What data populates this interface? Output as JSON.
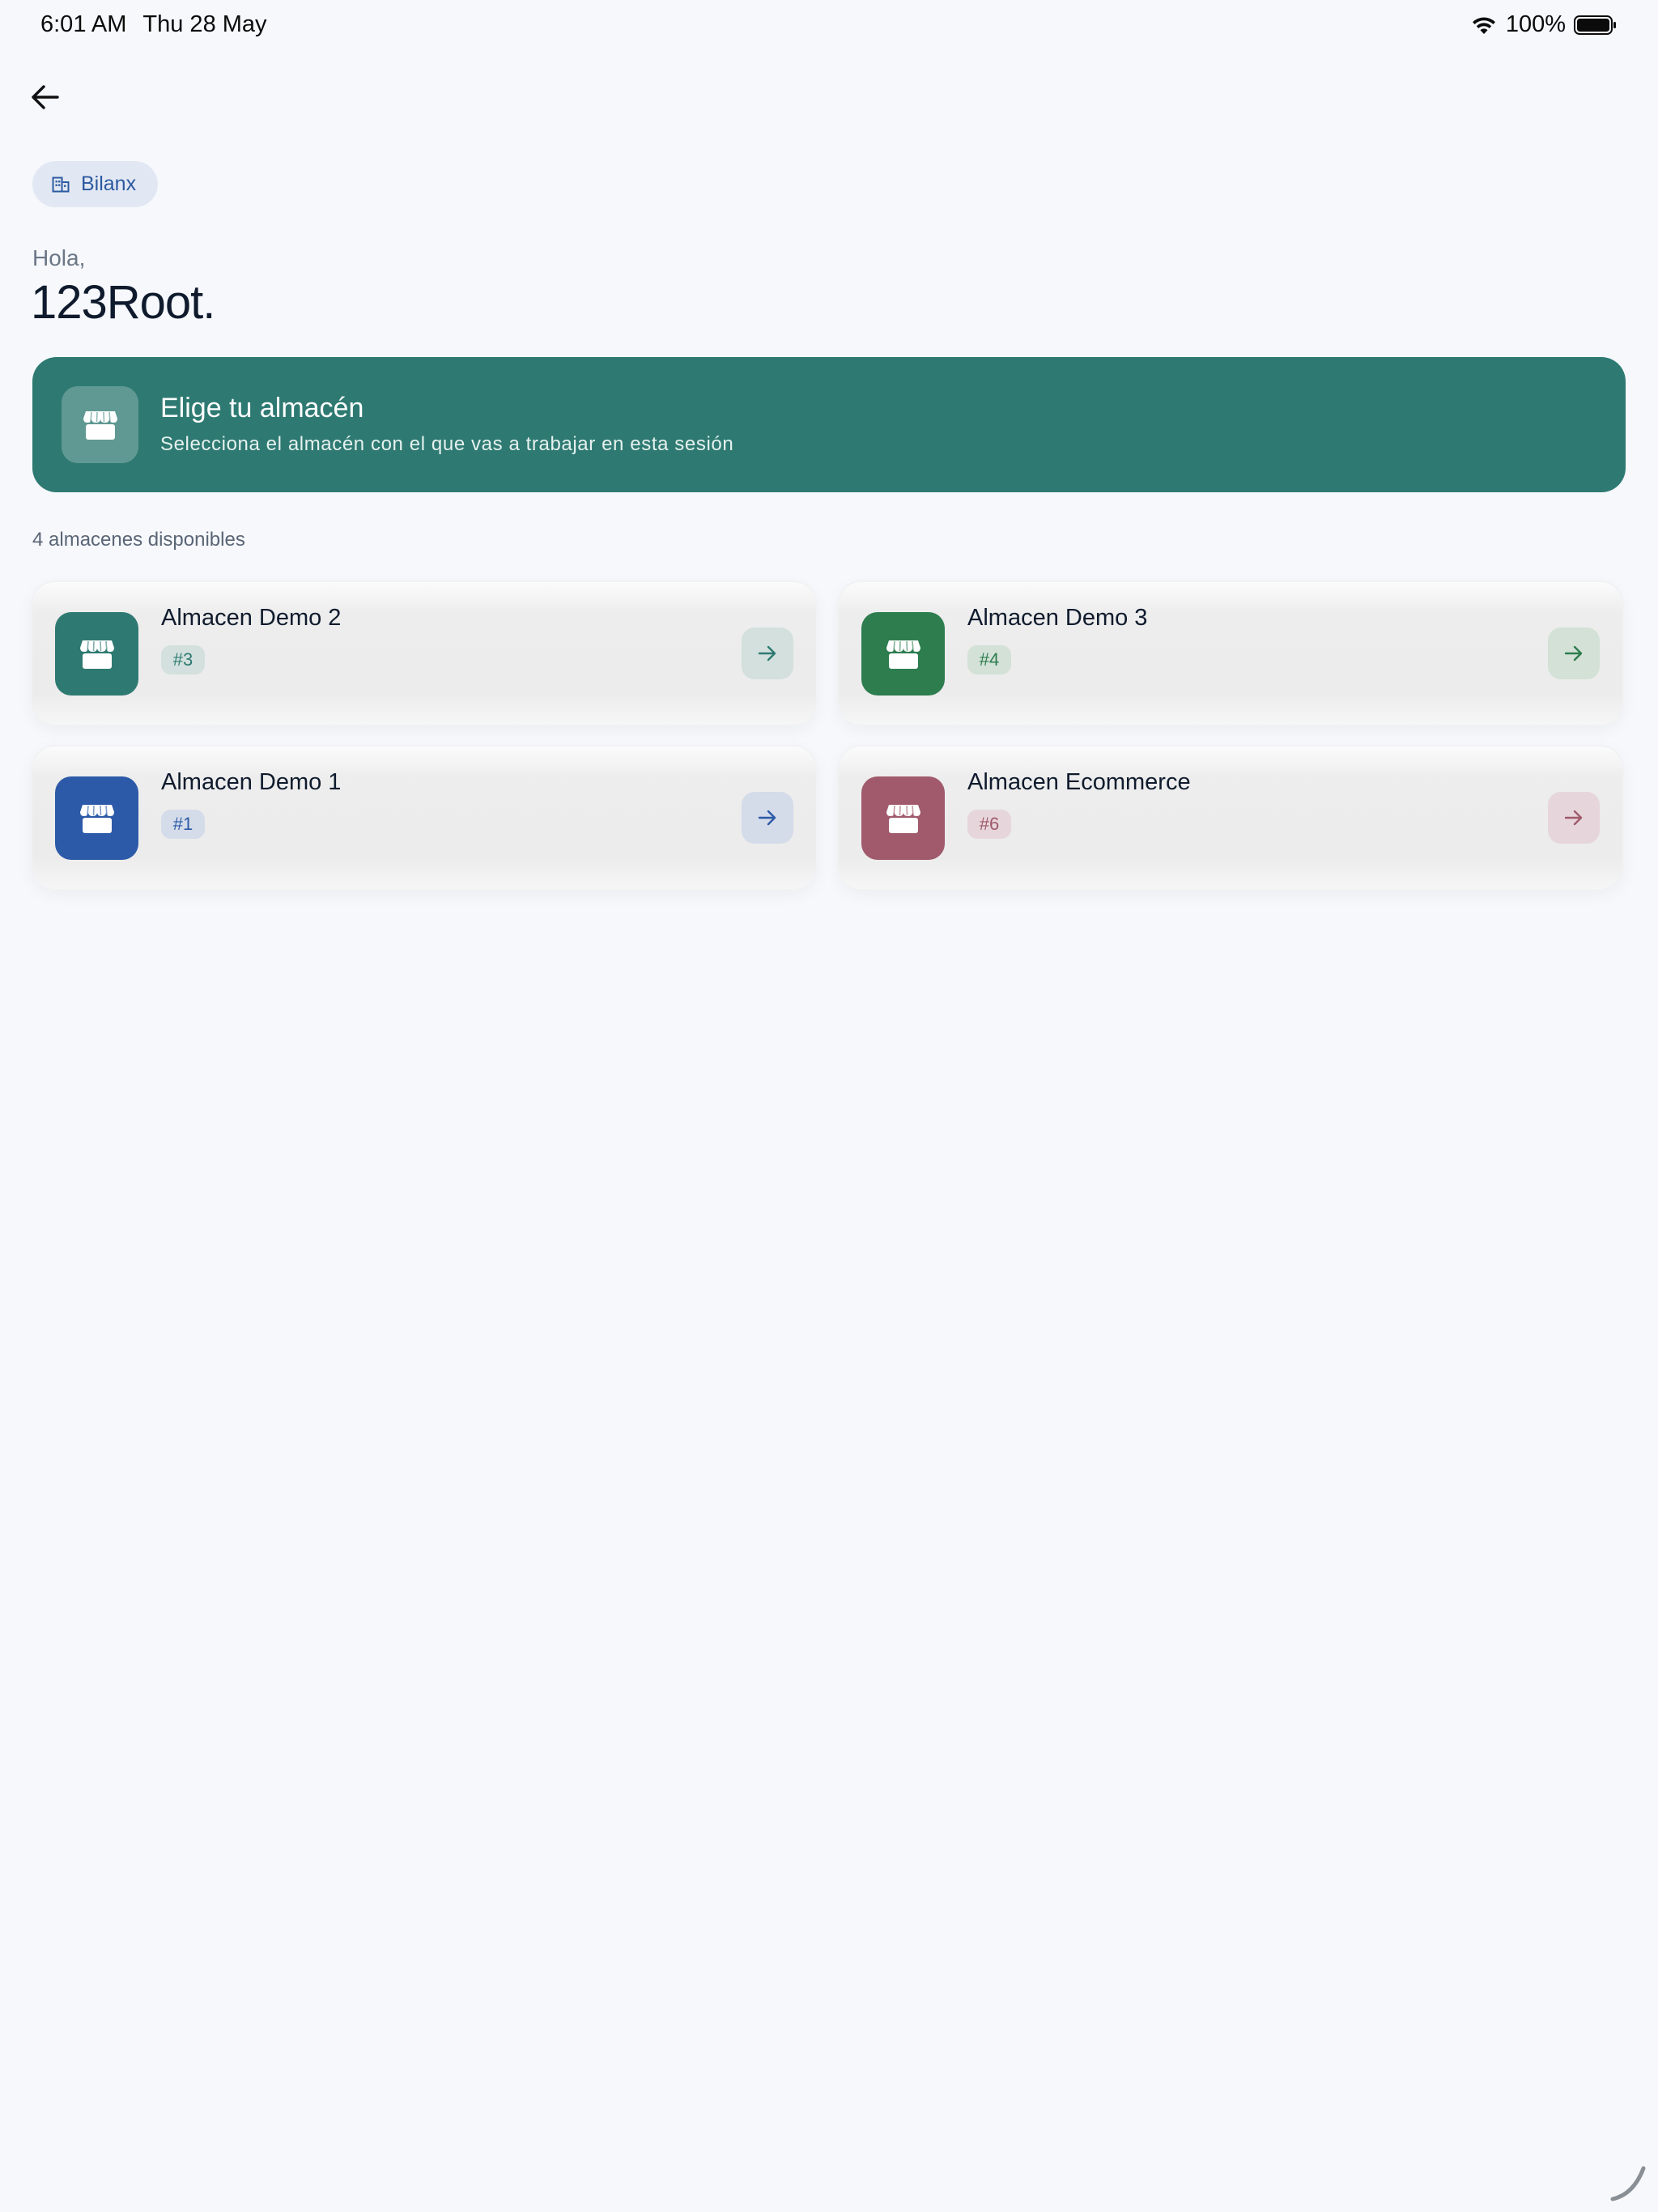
{
  "status_bar": {
    "time": "6:01 AM",
    "date": "Thu 28 May",
    "battery": "100%"
  },
  "header": {
    "back_icon": "arrow-left-icon",
    "org_chip_label": "Bilanx",
    "org_chip_icon": "building-icon"
  },
  "greeting": {
    "hello": "Hola,",
    "name": "123Root."
  },
  "hero": {
    "icon": "store-icon",
    "title": "Elige tu almacén",
    "subtitle": "Selecciona el almacén con el que vas a trabajar en esta sesión",
    "color": "#2e7a72"
  },
  "warehouses": {
    "count_label": "4 almacenes disponibles",
    "items": [
      {
        "name": "Almacen Demo 2",
        "id": "#3",
        "color": "#2e7a72",
        "tint": "#d3e0dd",
        "text_color": "#2e7a72"
      },
      {
        "name": "Almacen Demo 3",
        "id": "#4",
        "color": "#2d7d4f",
        "tint": "#d3e1d6",
        "text_color": "#2d7d4f"
      },
      {
        "name": "Almacen Demo 1",
        "id": "#1",
        "color": "#2c5aa8",
        "tint": "#d4dbe9",
        "text_color": "#2c5aa8"
      },
      {
        "name": "Almacen Ecommerce",
        "id": "#6",
        "color": "#a05a6c",
        "tint": "#e6d6db",
        "text_color": "#a05a6c"
      }
    ]
  }
}
